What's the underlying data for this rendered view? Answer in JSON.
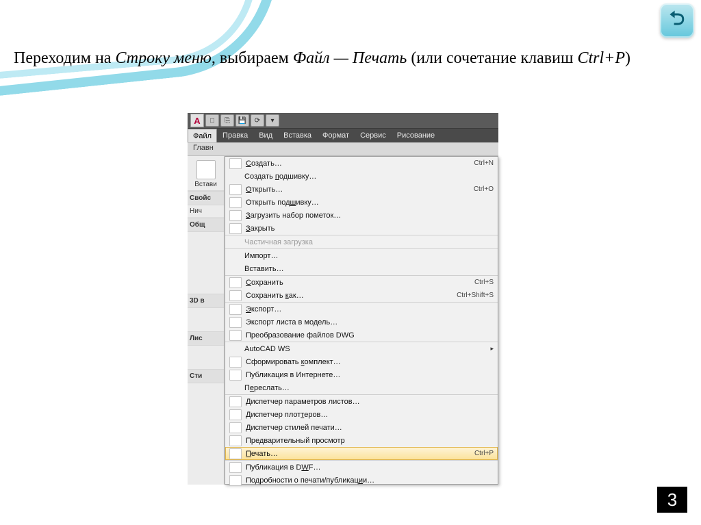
{
  "slide": {
    "caption_plain_1": "Переходим на ",
    "caption_em_1": "Строку меню",
    "caption_plain_2": ", выбираем ",
    "caption_em_2": "Файл — Печать",
    "caption_plain_3": " (или сочетание клавиш ",
    "caption_em_3": "Ctrl+P",
    "caption_plain_4": ")",
    "page_number": "3",
    "back_glyph": "⮌"
  },
  "app": {
    "logo_letter": "A",
    "qat": [
      "□",
      "⎘",
      "💾",
      "⟳",
      "▾"
    ],
    "menubar": [
      "Файл",
      "Правка",
      "Вид",
      "Вставка",
      "Формат",
      "Сервис",
      "Рисование"
    ],
    "ribbon_tab": "Главн",
    "left_button": "Встави",
    "left_panel_title": "Свойс",
    "left_listhead": "Нич",
    "left_groups": [
      "Общ",
      "3D в",
      "Лис",
      "Сти"
    ]
  },
  "menu": {
    "items": [
      {
        "icon": true,
        "label": "Создать…",
        "shortcut": "Ctrl+N",
        "ul": 0
      },
      {
        "icon": false,
        "label": "Создать подшивку…",
        "ul": 8
      },
      {
        "icon": true,
        "label": "Открыть…",
        "shortcut": "Ctrl+O",
        "ul": 0
      },
      {
        "icon": true,
        "label": "Открыть подшивку…",
        "ul": 11
      },
      {
        "icon": true,
        "label": "Загрузить набор пометок…",
        "ul": 0
      },
      {
        "icon": true,
        "label": "Закрыть",
        "ul": 0
      },
      {
        "icon": false,
        "label": "Частичная загрузка",
        "disabled": true,
        "sep": true
      },
      {
        "icon": false,
        "label": "Импорт…",
        "sep": true
      },
      {
        "icon": false,
        "label": "Вставить…"
      },
      {
        "icon": true,
        "label": "Сохранить",
        "shortcut": "Ctrl+S",
        "sep": true,
        "ul": 0
      },
      {
        "icon": true,
        "label": "Сохранить как…",
        "shortcut": "Ctrl+Shift+S",
        "ul": 10
      },
      {
        "icon": true,
        "label": "Экспорт…",
        "sep": true,
        "ul": 0
      },
      {
        "icon": true,
        "label": "Экспорт листа в модель…"
      },
      {
        "icon": true,
        "label": "Преобразование файлов DWG"
      },
      {
        "icon": false,
        "label": "AutoCAD WS",
        "sep": true,
        "submenu": true
      },
      {
        "icon": true,
        "label": "Сформировать комплект…",
        "ul": 13
      },
      {
        "icon": true,
        "label": "Публикация в Интернете…"
      },
      {
        "icon": false,
        "label": "Переслать…",
        "ul": 1
      },
      {
        "icon": true,
        "label": "Диспетчер параметров листов…",
        "sep": true,
        "ul": 28
      },
      {
        "icon": true,
        "label": "Диспетчер плоттеров…",
        "ul": 14
      },
      {
        "icon": true,
        "label": "Диспетчер стилей печати…"
      },
      {
        "icon": true,
        "label": "Предварительный просмотр",
        "ul": 3
      },
      {
        "icon": true,
        "label": "Печать…",
        "shortcut": "Ctrl+P",
        "sel": true,
        "ul": 0
      },
      {
        "icon": true,
        "label": "Публикация в DWF…",
        "sep": true,
        "ul": 14
      },
      {
        "icon": true,
        "label": "Подробности о печати/публикации…",
        "ul": 29
      }
    ]
  }
}
